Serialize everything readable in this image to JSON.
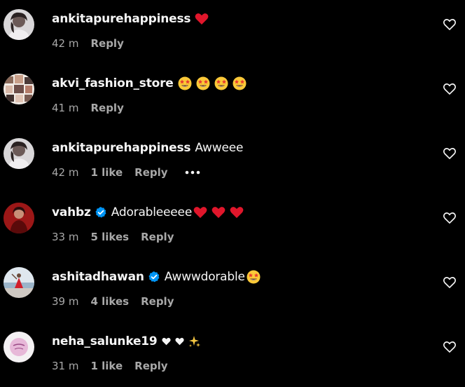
{
  "comments": [
    {
      "username": "ankitapurehappiness",
      "verified": false,
      "text": "",
      "emojis": [
        "heart"
      ],
      "time": "42 m",
      "likes": "",
      "reply": "Reply",
      "more": false,
      "avatar": "woman-portrait-avatar",
      "like_icon": "heart-outline-icon"
    },
    {
      "username": "akvi_fashion_store",
      "verified": false,
      "text": "",
      "emojis": [
        "star-struck",
        "star-struck",
        "star-struck",
        "star-struck"
      ],
      "time": "41 m",
      "likes": "",
      "reply": "Reply",
      "more": false,
      "avatar": "collage-avatar",
      "like_icon": "heart-outline-icon"
    },
    {
      "username": "ankitapurehappiness",
      "verified": false,
      "text": "Awweee",
      "emojis": [],
      "time": "42 m",
      "likes": "1 like",
      "reply": "Reply",
      "more": true,
      "avatar": "woman-portrait-avatar",
      "like_icon": "heart-outline-icon"
    },
    {
      "username": "vahbz",
      "verified": true,
      "text": "Adorableeeee",
      "emojis": [
        "heart",
        "heart",
        "heart"
      ],
      "time": "33 m",
      "likes": "5 likes",
      "reply": "Reply",
      "more": false,
      "avatar": "red-portrait-avatar",
      "like_icon": "heart-outline-icon"
    },
    {
      "username": "ashitadhawan",
      "verified": true,
      "text": "Awwwdorable",
      "emojis": [
        "star-struck"
      ],
      "time": "39 m",
      "likes": "4 likes",
      "reply": "Reply",
      "more": false,
      "avatar": "seaside-avatar",
      "like_icon": "heart-outline-icon"
    },
    {
      "username": "neha_salunke19",
      "verified": false,
      "text": "",
      "emojis": [
        "white-heart",
        "white-heart",
        "sparkles"
      ],
      "time": "31 m",
      "likes": "1 like",
      "reply": "Reply",
      "more": false,
      "avatar": "pink-logo-avatar",
      "like_icon": "heart-outline-icon"
    }
  ],
  "colors": {
    "background": "#000000",
    "primary_text": "#f5f5f5",
    "secondary_text": "#a8a8a8",
    "verified_badge": "#0095f6",
    "heart_emoji": "#e0162b"
  }
}
